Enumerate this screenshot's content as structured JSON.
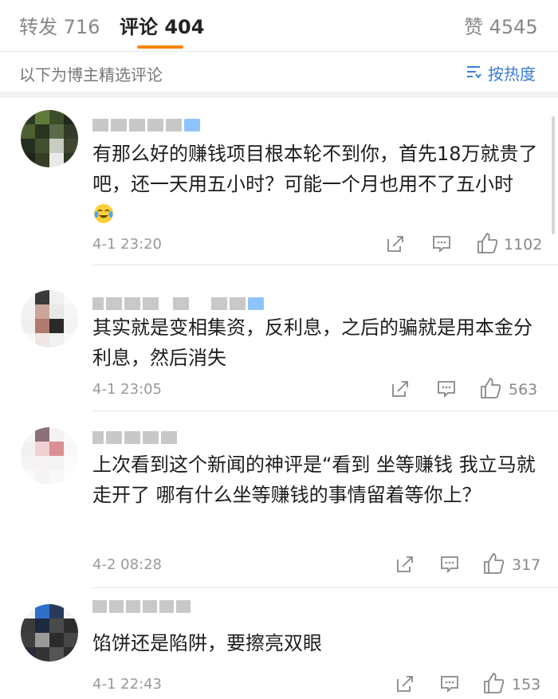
{
  "tabs": {
    "repost": "转发 716",
    "comments": "评论 404",
    "likes": "赞 4545"
  },
  "filter": {
    "label": "以下为博主精选评论",
    "sort_label": "按热度",
    "sort_icon": "sort-lines-icon"
  },
  "colors": {
    "accent": "#ff8200",
    "link": "#3a7bd5"
  },
  "comments": [
    {
      "text": "有那么好的赚钱项目根本轮不到你，首先18万就贵了吧，还一天用五小时？可能一个月也用不了五小时",
      "emoji": "laugh-cry-emoji",
      "time": "4-1 23:20",
      "likes": "1102"
    },
    {
      "text": "其实就是变相集资，反利息，之后的骗就是用本金分利息，然后消失",
      "time": "4-1 23:05",
      "likes": "563"
    },
    {
      "text": "上次看到这个新闻的神评是“看到 坐等赚钱 我立马就走开了 哪有什么坐等赚钱的事情留着等你上？",
      "time": "4-2 08:28",
      "likes": "317"
    },
    {
      "text": "馅饼还是陷阱，要擦亮双眼",
      "time": "4-1 22:43",
      "likes": "153"
    }
  ]
}
